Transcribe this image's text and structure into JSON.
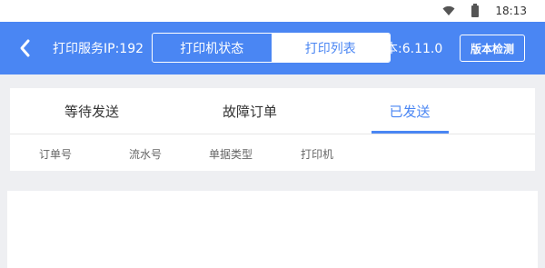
{
  "status_bar": {
    "time": "18:13",
    "icons": [
      "wifi-icon",
      "battery-icon"
    ]
  },
  "header": {
    "title_left": "打印服务IP:192",
    "title_right": "本:6.11.0",
    "segments": [
      {
        "label": "打印机状态",
        "active": false
      },
      {
        "label": "打印列表",
        "active": true
      }
    ],
    "version_button": "版本检测"
  },
  "tabs": [
    {
      "label": "等待发送",
      "active": false
    },
    {
      "label": "故障订单",
      "active": false
    },
    {
      "label": "已发送",
      "active": true
    }
  ],
  "columns": [
    "订单号",
    "流水号",
    "单据类型",
    "打印机"
  ],
  "colors": {
    "accent": "#4a86f3",
    "background": "#eeeff2"
  }
}
